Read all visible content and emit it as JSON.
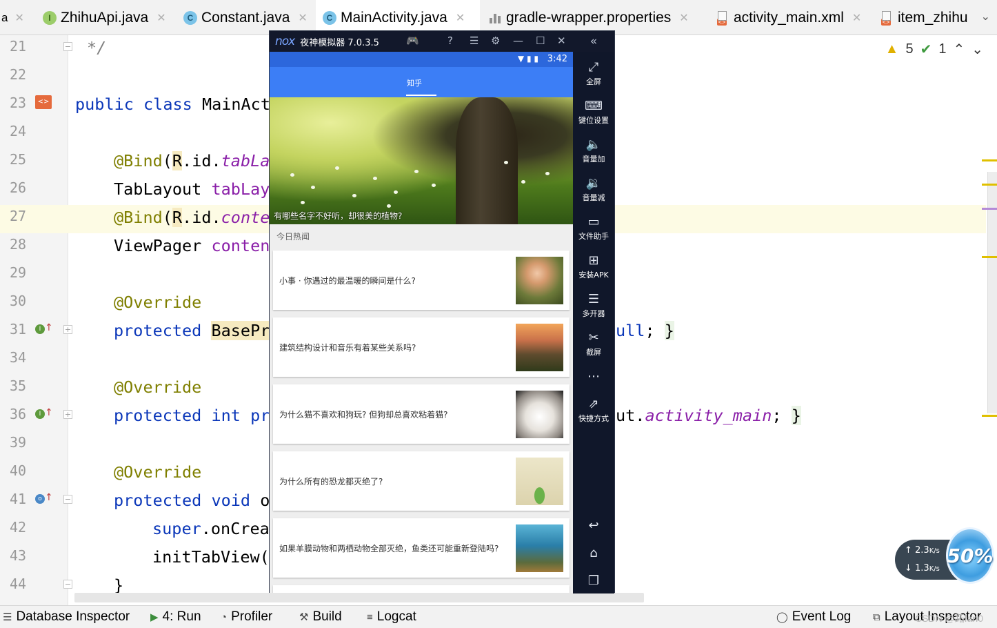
{
  "tabs": [
    {
      "label": "ZhihuApi.java",
      "icon": "interface-icon",
      "active": false
    },
    {
      "label": "Constant.java",
      "icon": "class-icon",
      "active": false
    },
    {
      "label": "MainActivity.java",
      "icon": "class-icon",
      "active": true
    },
    {
      "label": "gradle-wrapper.properties",
      "icon": "properties-icon",
      "active": false
    },
    {
      "label": "activity_main.xml",
      "icon": "xml-icon",
      "active": false
    },
    {
      "label": "item_zhihu",
      "icon": "xml-icon",
      "active": false
    }
  ],
  "editor": {
    "warnings": "5",
    "ok_count": "1",
    "lines": [
      {
        "n": "21",
        "text": "*/"
      },
      {
        "n": "22",
        "text": ""
      },
      {
        "n": "23",
        "text": "public class MainAct"
      },
      {
        "n": "24",
        "text": ""
      },
      {
        "n": "25",
        "text": "@Bind(R.id.tabLa"
      },
      {
        "n": "26",
        "text": "TabLayout tabLay"
      },
      {
        "n": "27",
        "text": "@Bind(R.id.conte"
      },
      {
        "n": "28",
        "text": "ViewPager conten"
      },
      {
        "n": "29",
        "text": ""
      },
      {
        "n": "30",
        "text": "@Override"
      },
      {
        "n": "31",
        "text": "protected BasePr",
        "tail": "ull; }"
      },
      {
        "n": "34",
        "text": ""
      },
      {
        "n": "35",
        "text": "@Override"
      },
      {
        "n": "36",
        "text": "protected int pr",
        "tail": "ut.activity_main; }"
      },
      {
        "n": "39",
        "text": ""
      },
      {
        "n": "40",
        "text": "@Override"
      },
      {
        "n": "41",
        "text": "protected void o"
      },
      {
        "n": "42",
        "text": "super.onCrea"
      },
      {
        "n": "43",
        "text": "initTabView("
      },
      {
        "n": "44",
        "text": "}"
      }
    ]
  },
  "emulator": {
    "logo": "nox",
    "title": "夜神模拟器 7.0.3.5",
    "clock": "3:42",
    "app_tab": "知乎",
    "banner_caption": "有哪些名字不好听，却很美的植物?",
    "section_title": "今日热闻",
    "stories": [
      {
        "title": "小事 · 你遇过的最温暖的瞬间是什么?",
        "thumb": "children-photo"
      },
      {
        "title": "建筑结构设计和音乐有着某些关系吗?",
        "thumb": "castle-photo"
      },
      {
        "title": "为什么猫不喜欢和狗玩? 但狗却总喜欢粘着猫?",
        "thumb": "kitten-photo"
      },
      {
        "title": "为什么所有的恐龙都灭绝了?",
        "thumb": "dinosaur-photo"
      },
      {
        "title": "如果羊膜动物和两栖动物全部灭绝，鱼类还可能重新登陆吗?",
        "thumb": "reef-photo"
      }
    ],
    "sidebar": [
      {
        "label": "全屏",
        "icon": "fullscreen-icon"
      },
      {
        "label": "键位设置",
        "icon": "keyboard-icon"
      },
      {
        "label": "音量加",
        "icon": "volume-up-icon"
      },
      {
        "label": "音量减",
        "icon": "volume-down-icon"
      },
      {
        "label": "文件助手",
        "icon": "file-icon"
      },
      {
        "label": "安装APK",
        "icon": "apk-icon"
      },
      {
        "label": "多开器",
        "icon": "multi-instance-icon"
      },
      {
        "label": "截屏",
        "icon": "scissors-icon"
      },
      {
        "label": "",
        "icon": "more-icon"
      },
      {
        "label": "快捷方式",
        "icon": "shortcut-icon"
      }
    ]
  },
  "toolwindows": [
    {
      "label": "Database Inspector",
      "icon": "database-icon"
    },
    {
      "label": "4: Run",
      "icon": "run-icon"
    },
    {
      "label": "Profiler",
      "icon": "profiler-icon"
    },
    {
      "label": "Build",
      "icon": "hammer-icon"
    },
    {
      "label": "Logcat",
      "icon": "logcat-icon"
    },
    {
      "label": "Event Log",
      "icon": "event-log-icon"
    },
    {
      "label": "Layout Inspector",
      "icon": "layout-inspector-icon"
    }
  ],
  "watermark": "CSDN @跖fan0",
  "netspeed": {
    "up": "2.3",
    "down": "1.3",
    "unit": "K/s",
    "ball": "50%"
  },
  "colors": {
    "accent": "#4a88c7",
    "keyword": "#0b37b9",
    "annotation": "#7f7f00",
    "field": "#8a1fa8",
    "app_bar": "#3c7ef6",
    "emulator_bg": "#10172a"
  }
}
